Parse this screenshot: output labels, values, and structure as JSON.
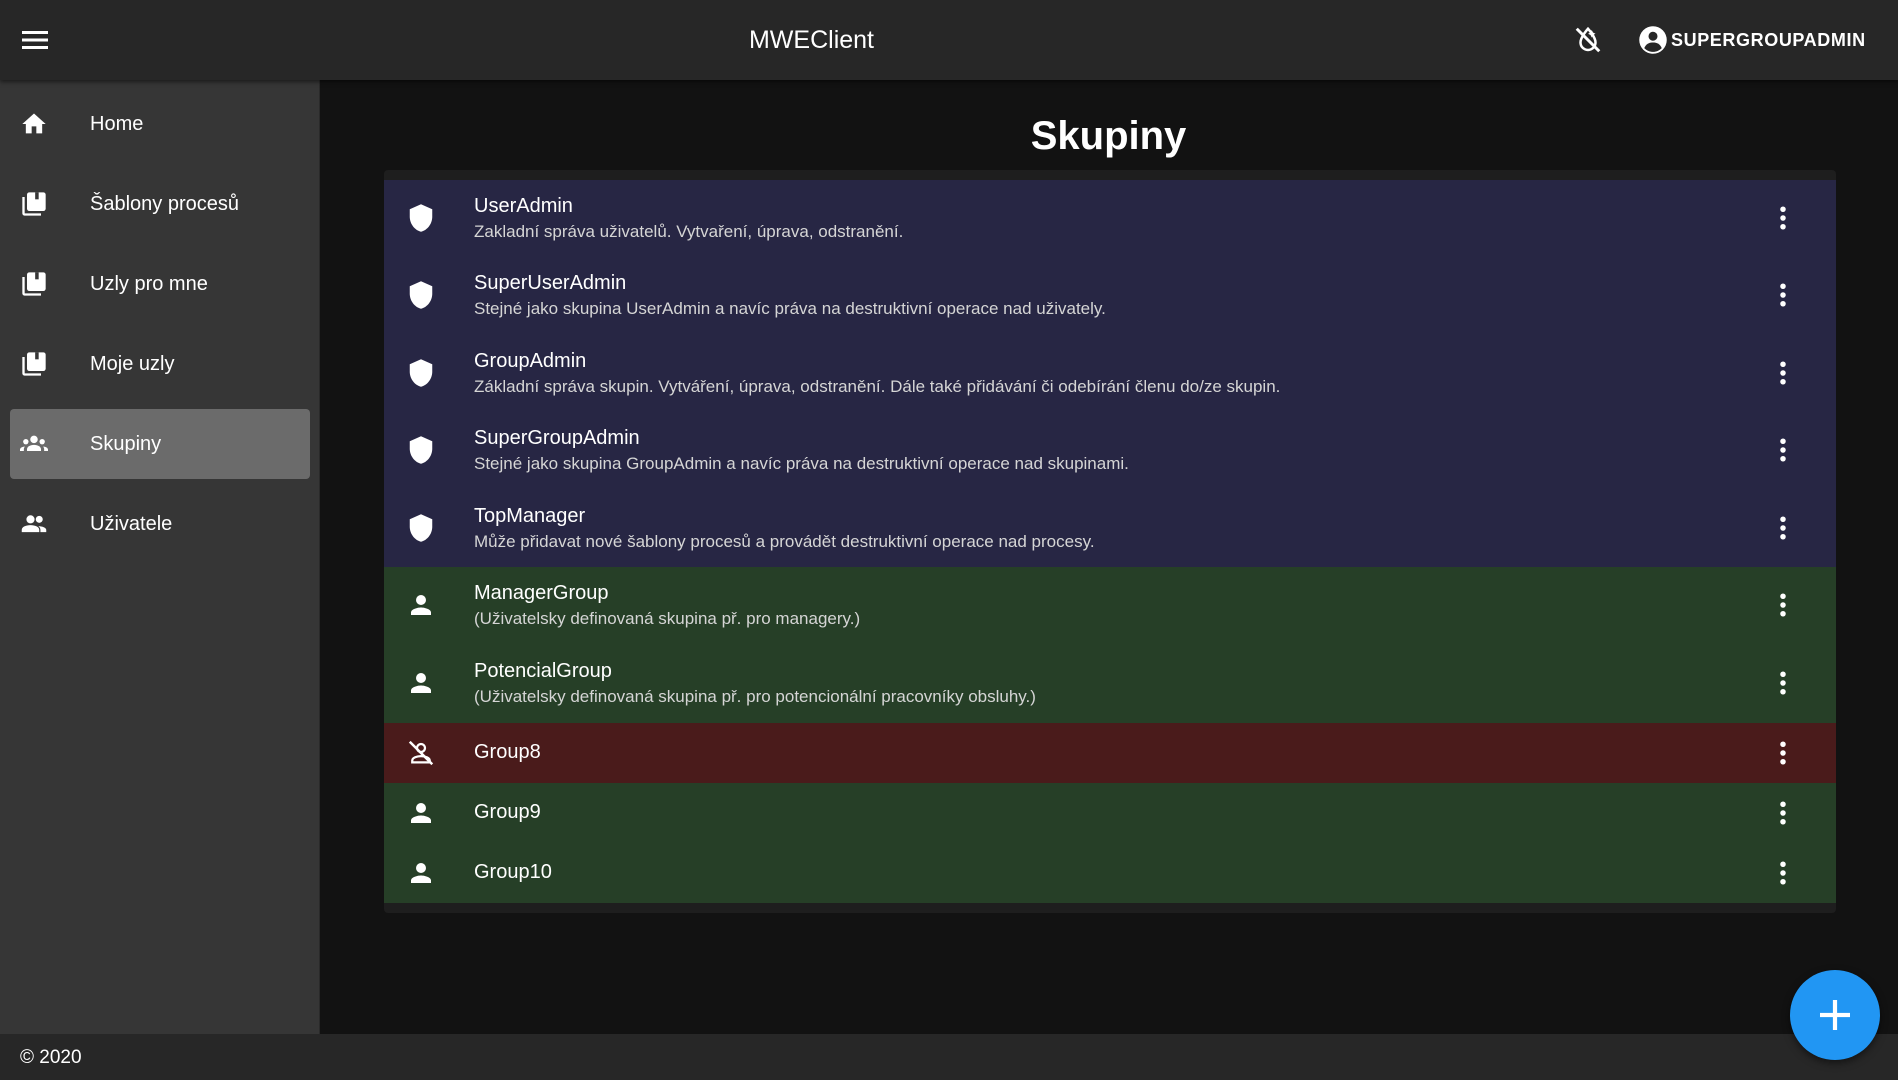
{
  "app": {
    "title": "MWEClient"
  },
  "header": {
    "account_label": "SUPERGROUPADMIN"
  },
  "sidebar": {
    "items": [
      {
        "label": "Home",
        "icon": "home-icon"
      },
      {
        "label": "Šablony procesů",
        "icon": "library-books-icon"
      },
      {
        "label": "Uzly pro mne",
        "icon": "library-books-icon"
      },
      {
        "label": "Moje uzly",
        "icon": "library-books-icon"
      },
      {
        "label": "Skupiny",
        "icon": "groups-icon",
        "active": true
      },
      {
        "label": "Uživatele",
        "icon": "people-icon"
      }
    ]
  },
  "main": {
    "title": "Skupiny",
    "groups": [
      {
        "name": "UserAdmin",
        "description": "Zakladní správa uživatelů. Vytvaření, úprava, odstranění.",
        "kind": "system",
        "icon": "shield-icon"
      },
      {
        "name": "SuperUserAdmin",
        "description": "Stejné jako skupina UserAdmin a navíc práva na destruktivní operace nad uživately.",
        "kind": "system",
        "icon": "shield-icon"
      },
      {
        "name": "GroupAdmin",
        "description": "Základní správa skupin. Vytváření, úprava, odstranění. Dále také přidávání či odebírání členu do/ze skupin.",
        "kind": "system",
        "icon": "shield-icon"
      },
      {
        "name": "SuperGroupAdmin",
        "description": "Stejné jako skupina GroupAdmin a navíc práva na destruktivní operace nad skupinami.",
        "kind": "system",
        "icon": "shield-icon"
      },
      {
        "name": "TopManager",
        "description": "Může přidavat nové šablony procesů a provádět destruktivní operace nad procesy.",
        "kind": "system",
        "icon": "shield-icon"
      },
      {
        "name": "ManagerGroup",
        "description": "(Uživatelsky definovaná skupina př. pro managery.)",
        "kind": "user",
        "icon": "person-icon"
      },
      {
        "name": "PotencialGroup",
        "description": "(Uživatelsky definovaná skupina př. pro potencionální pracovníky obsluhy.)",
        "kind": "user",
        "icon": "person-icon"
      },
      {
        "name": "Group8",
        "description": "",
        "kind": "disabled",
        "icon": "person-off-icon"
      },
      {
        "name": "Group9",
        "description": "",
        "kind": "user",
        "icon": "person-icon"
      },
      {
        "name": "Group10",
        "description": "",
        "kind": "user",
        "icon": "person-icon"
      }
    ]
  },
  "footer": {
    "copyright": "© 2020"
  },
  "colors": {
    "system_row": "#272644",
    "user_row": "#263f27",
    "disabled_row": "#4a1b1b",
    "fab": "#2196f3",
    "active_nav": "#6b6b6b"
  },
  "fab": {
    "icon": "add-icon"
  }
}
